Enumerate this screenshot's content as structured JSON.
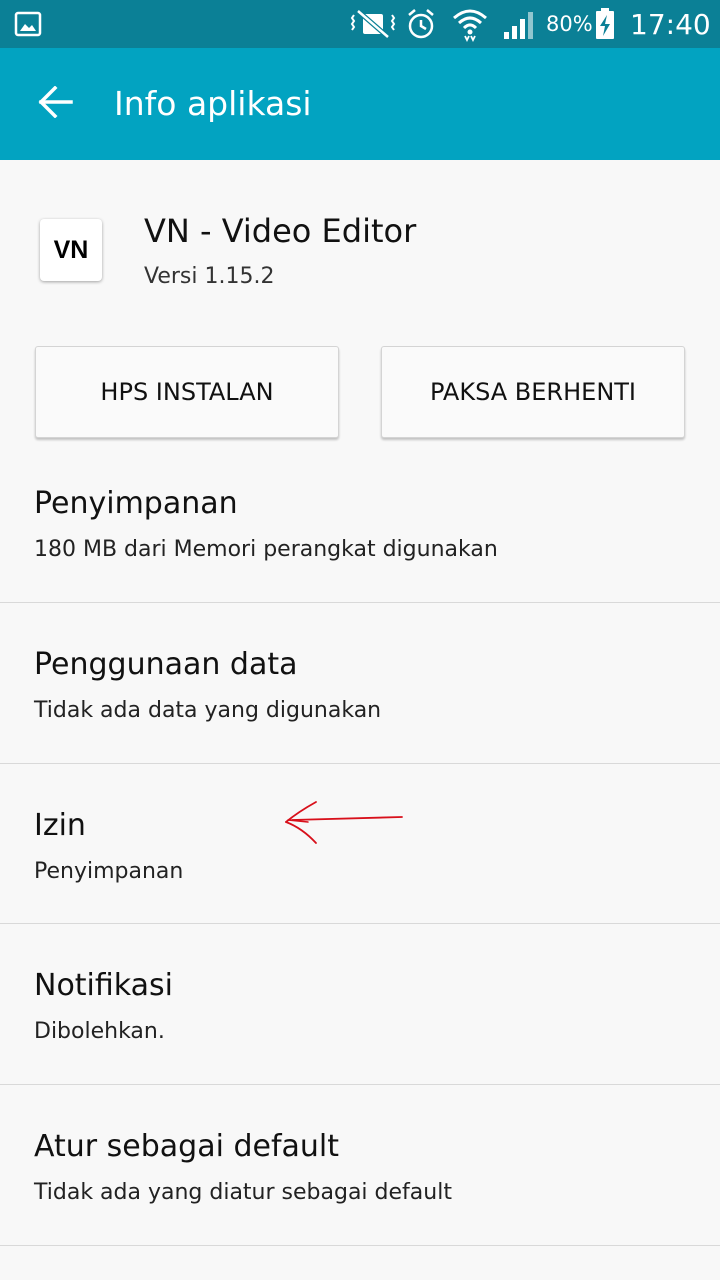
{
  "status_bar": {
    "icons": [
      "gallery-icon",
      "mute-icon",
      "alarm-icon",
      "wifi-icon",
      "signal-icon",
      "battery-icon"
    ],
    "battery": "80%",
    "time": "17:40"
  },
  "app_bar": {
    "title": "Info aplikasi",
    "back_icon": "arrow-left-icon"
  },
  "app": {
    "icon_text": "VN",
    "name": "VN - Video Editor",
    "version": "Versi 1.15.2"
  },
  "buttons": {
    "uninstall": "HPS INSTALAN",
    "force_stop": "PAKSA BERHENTI"
  },
  "settings": [
    {
      "title": "Penyimpanan",
      "subtitle": "180 MB dari Memori perangkat digunakan"
    },
    {
      "title": "Penggunaan data",
      "subtitle": "Tidak ada data yang digunakan"
    },
    {
      "title": "Izin",
      "subtitle": "Penyimpanan"
    },
    {
      "title": "Notifikasi",
      "subtitle": "Dibolehkan."
    },
    {
      "title": "Atur sebagai default",
      "subtitle": "Tidak ada yang diatur sebagai default"
    }
  ],
  "colors": {
    "status_bar": "#0b8096",
    "app_bar": "#02a3c1",
    "annotation": "#d8101b"
  }
}
